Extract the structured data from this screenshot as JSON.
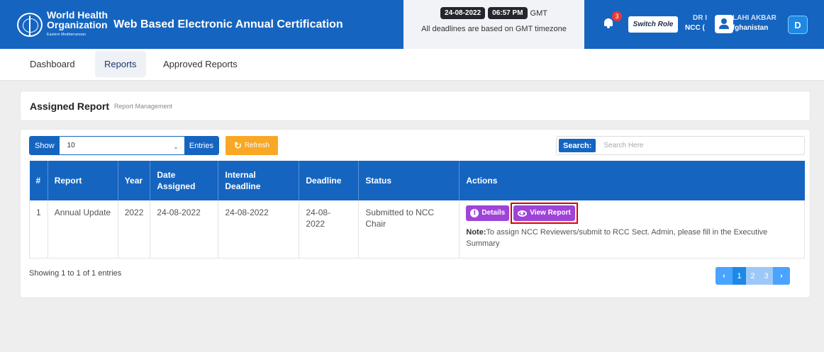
{
  "header": {
    "org_line1": "World Health",
    "org_line2": "Organization",
    "org_line3": "Eastern Mediterranean",
    "app_title": "Web Based Electronic Annual Certification",
    "date": "24-08-2022",
    "time": "06:57 PM",
    "tz": "GMT",
    "tz_note": "All deadlines are based on GMT timezone",
    "notification_count": "3",
    "switch_role_label": "Switch Role",
    "user_line1": "DR I",
    "user_line1b": "LAHI AKBAR",
    "user_line2": "NCC (",
    "user_line2b": "fghanistan",
    "avatar_letter": "D"
  },
  "nav": {
    "items": [
      {
        "label": "Dashboard"
      },
      {
        "label": "Reports"
      },
      {
        "label": "Approved Reports"
      }
    ],
    "active": "Reports"
  },
  "page": {
    "title": "Assigned Report",
    "subtitle": "Report Management"
  },
  "controls": {
    "show_label": "Show",
    "show_value": "10",
    "entries_label": "Entries",
    "refresh_label": "Refresh",
    "search_label": "Search:",
    "search_placeholder": "Search Here"
  },
  "table": {
    "headers": [
      "#",
      "Report",
      "Year",
      "Date Assigned",
      "Internal Deadline",
      "Deadline",
      "Status",
      "Actions"
    ],
    "rows": [
      {
        "num": "1",
        "report": "Annual Update",
        "year": "2022",
        "date_assigned": "24-08-2022",
        "internal_deadline": "24-08-2022",
        "deadline": "24-08-2022",
        "status": "Submitted to NCC Chair",
        "details_label": "Details",
        "view_label": "View Report",
        "note_prefix": "Note:",
        "note_text": "To assign NCC Reviewers/submit to RCC Sect. Admin, please fill in the Executive Summary"
      }
    ]
  },
  "footer": {
    "showing": "Showing 1 to 1 of 1 entries",
    "pages": [
      "1",
      "2",
      "3"
    ],
    "prev": "‹",
    "next": "›"
  },
  "colors": {
    "primary": "#1565c0",
    "refresh": "#f9a825",
    "action": "#a043d9",
    "highlight": "#e00000"
  }
}
